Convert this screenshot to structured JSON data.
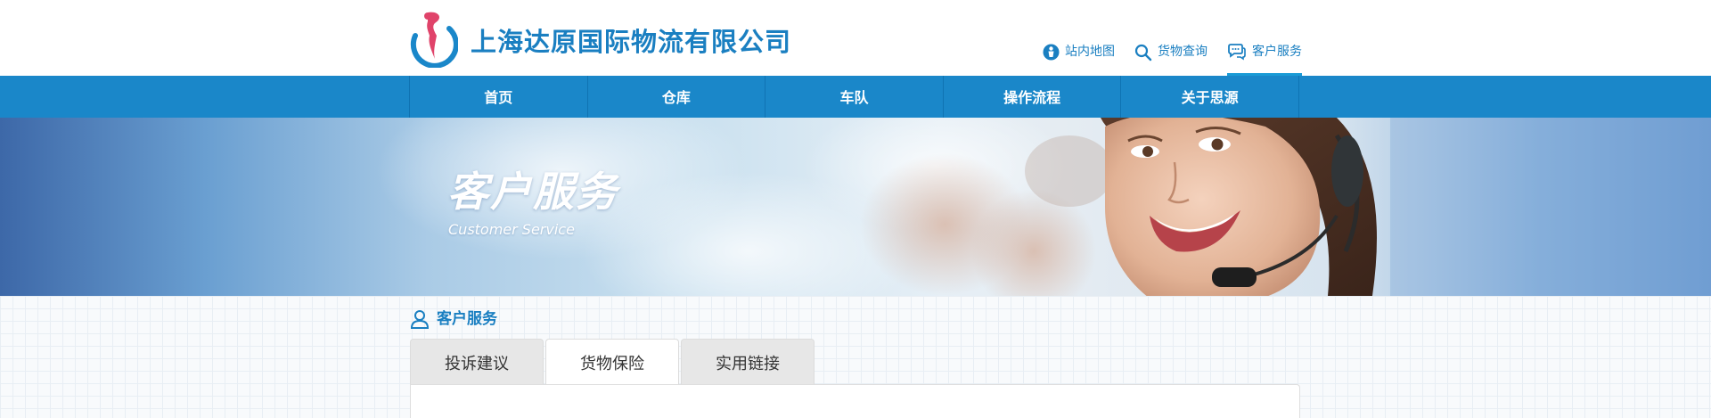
{
  "header": {
    "company_name": "上海达原国际物流有限公司",
    "top_links": [
      {
        "label": "站内地图",
        "icon": "sitemap-icon"
      },
      {
        "label": "货物查询",
        "icon": "search-icon"
      },
      {
        "label": "客户服务",
        "icon": "chat-icon"
      }
    ]
  },
  "nav": {
    "items": [
      "首页",
      "仓库",
      "车队",
      "操作流程",
      "关于思源"
    ]
  },
  "banner": {
    "title": "客户服务",
    "subtitle": "Customer Service"
  },
  "main": {
    "section_title": "客户服务",
    "section_icon": "user-icon",
    "tabs": [
      {
        "label": "投诉建议",
        "active": false
      },
      {
        "label": "货物保险",
        "active": true
      },
      {
        "label": "实用链接",
        "active": false
      }
    ]
  },
  "colors": {
    "brand_blue": "#1a7fc1",
    "nav_blue": "#1a87c9",
    "logo_red": "#e0436a"
  }
}
